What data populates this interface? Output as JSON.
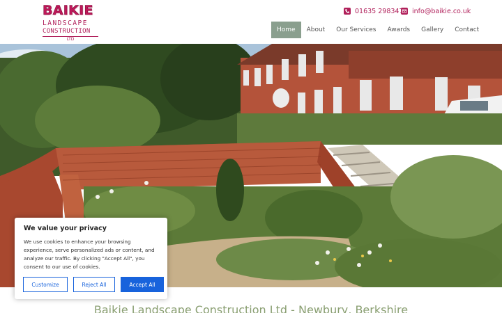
{
  "brand": {
    "name": "BAIKIE",
    "line2": "LANDSCAPE",
    "line3": "CONSTRUCTION",
    "line4": "LTD",
    "color": "#b01f5a"
  },
  "contact": {
    "phone": "01635 298347",
    "phone_icon": "phone-icon",
    "email": "info@baikie.co.uk",
    "email_icon": "envelope-icon"
  },
  "nav": {
    "items": [
      {
        "label": "Home",
        "active": true
      },
      {
        "label": "About",
        "active": false
      },
      {
        "label": "Our Services",
        "active": false
      },
      {
        "label": "Awards",
        "active": false
      },
      {
        "label": "Gallery",
        "active": false
      },
      {
        "label": "Contact",
        "active": false
      }
    ],
    "active_color": "#8a9f8e"
  },
  "tagline": "Baikie Landscape Construction Ltd - Newbury, Berkshire",
  "cookie": {
    "title": "We value your privacy",
    "text": "We use cookies to enhance your browsing experience, serve personalized ads or content, and analyze our traffic. By clicking \"Accept All\", you consent to our use of cookies.",
    "customize": "Customize",
    "reject": "Reject All",
    "accept": "Accept All",
    "accent": "#1863dc"
  }
}
